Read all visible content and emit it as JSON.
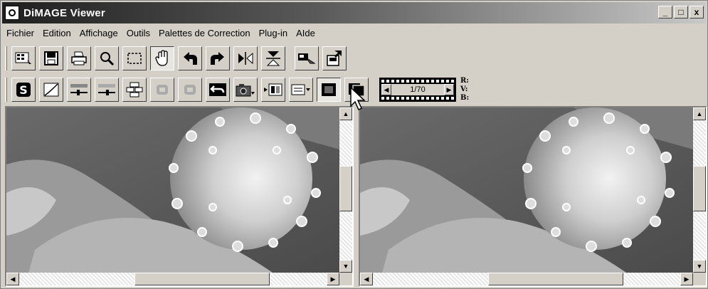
{
  "window": {
    "title": "DiMAGE Viewer"
  },
  "window_buttons": {
    "minimize": "_",
    "maximize": "□",
    "close": "x"
  },
  "menu": [
    "Fichier",
    "Edition",
    "Affichage",
    "Outils",
    "Palettes de Correction",
    "Plug-in",
    "AIde"
  ],
  "toolbar1": [
    "index-view-icon",
    "save-icon",
    "print-icon",
    "zoom-icon",
    "select-icon",
    "hand-icon",
    "rotate-left-icon",
    "rotate-right-icon",
    "flip-horizontal-icon",
    "flip-vertical-icon",
    "camera-settings-icon",
    "export-icon"
  ],
  "toolbar2": [
    "variation-icon",
    "curves-icon",
    "brightness-contrast-icon",
    "color-balance-icon",
    "grid-icon",
    "undo-icon",
    "redo-icon",
    "reset-icon",
    "snapshot-icon",
    "compare-icon",
    "view-mode-icon",
    "before-after-icon",
    "full-image-icon"
  ],
  "filmstrip": {
    "counter": "1/70",
    "prev_arrow": "◀",
    "next_arrow": "▶"
  },
  "rgb_readout": {
    "r": "R:",
    "v": "V:",
    "b": "B:"
  },
  "colors": {
    "title_gradient_start": "#1f1f1f",
    "face": "#d4d0c8"
  }
}
